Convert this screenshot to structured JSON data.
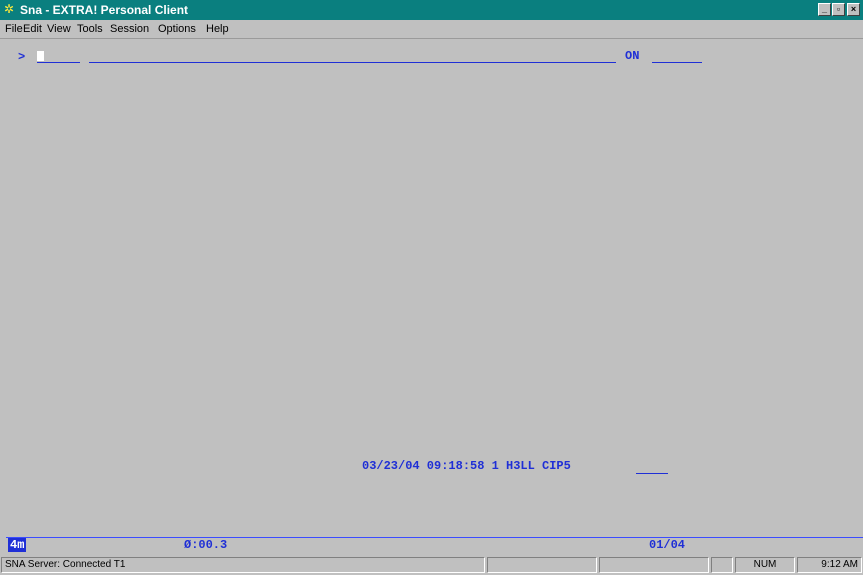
{
  "window": {
    "title": "Sna - EXTRA! Personal Client",
    "controls": {
      "minimize": "_",
      "restore": "▫",
      "close": "×"
    }
  },
  "menu": [
    "File",
    "Edit",
    "View",
    "Tools",
    "Session",
    "Options",
    "Help"
  ],
  "terminal": {
    "prompt": ">",
    "field_label": "ON",
    "footer_line": "03/23/04  09:18:58 1 H3LL CIP5"
  },
  "oia": {
    "indicator": "4m",
    "timer": "Ø:00.3",
    "page": "01/04"
  },
  "statusbar": {
    "connection": "SNA Server: Connected T1",
    "num": "NUM",
    "time": "9:12 AM"
  },
  "colors": {
    "titlebar": "#0a7f7f",
    "terminal_text": "#1f2fd6",
    "background": "#c0c0c0"
  }
}
